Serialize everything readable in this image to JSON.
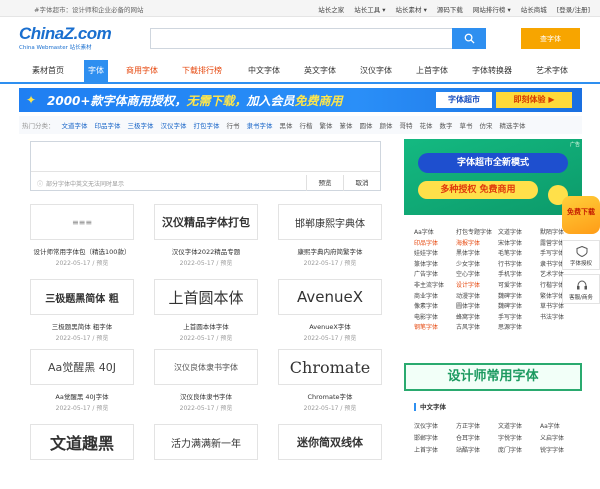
{
  "topbar": {
    "tagline": "#字体超市：设计师和企业必备的网站",
    "links": [
      "站长之家",
      "站长工具 ▾",
      "站长素材 ▾",
      "源码下载",
      "网站排行榜 ▾",
      "站长商城",
      "[登录/注册]"
    ]
  },
  "logo": {
    "main": "ChinaZ.com",
    "sub": "China Webmaster 站长素材"
  },
  "search": {
    "placeholder": "",
    "font_button": "查字体"
  },
  "nav": [
    {
      "label": "素材首页"
    },
    {
      "label": "字体"
    },
    {
      "label": "商用字体"
    },
    {
      "label": "下载排行榜"
    },
    {
      "label": "中文字体"
    },
    {
      "label": "英文字体"
    },
    {
      "label": "汉仪字体"
    },
    {
      "label": "上首字体"
    },
    {
      "label": "字体转换器"
    },
    {
      "label": "艺术字体"
    }
  ],
  "banner": {
    "text_a": "2000+款字体商用授权，",
    "text_b": "无需下载，",
    "text_c": "加入会员",
    "text_d": "免费商用",
    "box": "字体超市",
    "cta": "即刻体验 ▶"
  },
  "hot": {
    "label": "热门分类：",
    "bold": [
      "文道字体",
      "印品字体",
      "三极字体",
      "汉仪字体",
      "打包字体"
    ],
    "plain": [
      "行书",
      "隶书字体",
      "黑体",
      "行楷",
      "繁体",
      "篆体",
      "圆体",
      "颜体",
      "哥特",
      "花体",
      "数字",
      "草书",
      "仿宋",
      "精选字体"
    ]
  },
  "editor": {
    "note": "部分字体中英文无法同时显示",
    "preview": "预览",
    "cancel": "取消"
  },
  "cards": [
    {
      "sample": "≡≡≡",
      "title": "设计师常用字体包（精选100款）",
      "date": "2022-05-17",
      "label": "预览"
    },
    {
      "sample": "汉仪精品字体打包",
      "title": "汉仪字体2022精品专题",
      "date": "2022-05-17",
      "label": "预览"
    },
    {
      "sample": "邯郸康熙字典体",
      "title": "康熙字典内府简繁字体",
      "date": "2022-05-17",
      "label": "预览"
    },
    {
      "sample": "三极题黑简体 粗",
      "title": "三极题黑简体 粗字体",
      "date": "2022-05-17",
      "label": "预览"
    },
    {
      "sample": "上首圆本体",
      "title": "上首圆本体字体",
      "date": "2022-05-17",
      "label": "预览"
    },
    {
      "sample": "AvenueX",
      "title": "AvenueX字体",
      "date": "2022-05-17",
      "label": "预览"
    },
    {
      "sample": "Aa觉醒黑 40J",
      "title": "Aa觉醒黑 40J字体",
      "date": "2022-05-17",
      "label": "预览"
    },
    {
      "sample": "汉仪良体隶书字体",
      "title": "汉仪良体隶书字体",
      "date": "2022-05-17",
      "label": "预览"
    },
    {
      "sample": "Chromate",
      "title": "Chromate字体",
      "date": "2022-05-17",
      "label": "预览"
    },
    {
      "sample": "文道趣黑",
      "title": "",
      "date": "",
      "label": ""
    },
    {
      "sample": "活力满满新一年",
      "title": "",
      "date": "",
      "label": ""
    },
    {
      "sample": "迷你简双线体",
      "title": "",
      "date": "",
      "label": ""
    }
  ],
  "right_ad": {
    "line1": "字体超市全新模式",
    "line2": "多种授权 免费商用",
    "tag": "广告"
  },
  "tags": [
    [
      "Aa字体",
      "打包专题字体",
      "文道字体",
      "默陌字体"
    ],
    [
      "印品字体",
      "海报字体",
      "宋体字体",
      "露营字体"
    ],
    [
      "娃娃字体",
      "黑体字体",
      "毛笔字体",
      "手写字体"
    ],
    [
      "篆体字体",
      "少女字体",
      "行书字体",
      "隶书字体"
    ],
    [
      "广告字体",
      "空心字体",
      "手机字体",
      "艺术字体"
    ],
    [
      "非主流字体",
      "设计字体",
      "可爱字体",
      "行楷字体"
    ],
    [
      "商业字体",
      "动漫字体",
      "魏碑字体",
      "繁体字体"
    ],
    [
      "像素字体",
      "圆体字体",
      "魏碑字体",
      "草书字体"
    ],
    [
      "电影字体",
      "蜂窝字体",
      "手写字体",
      "书法字体"
    ],
    [
      "钢笔字体",
      "古风字体",
      "思源字体",
      ""
    ]
  ],
  "tags_orange": [
    "印品字体",
    "海报字体",
    "设计字体",
    "钢笔字体"
  ],
  "right_banner2": "设计师常用字体",
  "cn_title": "中文字体",
  "cn_list": [
    [
      "汉仪字体",
      "方正字体",
      "文道字体",
      "Aa字体"
    ],
    [
      "邯郸字体",
      "仓耳字体",
      "字悦字体",
      "义启字体"
    ],
    [
      "上首字体",
      "站酷字体",
      "庞门字体",
      "锐字字体"
    ]
  ],
  "float": {
    "vip": "免费下载",
    "help": "字体授权",
    "service": "客服/商务"
  }
}
